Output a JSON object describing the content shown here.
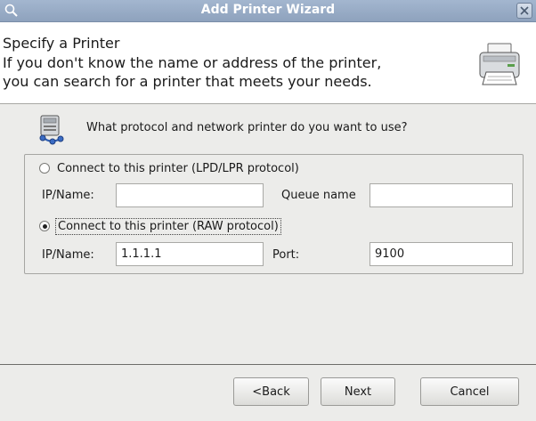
{
  "window": {
    "title": "Add Printer Wizard",
    "icons": {
      "title_left": "search-icon",
      "title_right": "close-icon"
    }
  },
  "header": {
    "title": "Specify a Printer",
    "description": " If you don't know the name or address of the printer,\nyou can search for a printer that meets your needs.",
    "icon": "printer-icon"
  },
  "body": {
    "question": "What protocol and network printer do you want to use?",
    "question_icon": "network-printer-icon",
    "lpd": {
      "label": "Connect to this printer (LPD/LPR protocol)",
      "selected": false,
      "ip_label": "IP/Name:",
      "ip_value": "",
      "queue_label": "Queue name",
      "queue_value": ""
    },
    "raw": {
      "label": "Connect to this printer (RAW protocol)",
      "selected": true,
      "ip_label": "IP/Name:",
      "ip_value": "1.1.1.1",
      "port_label": "Port:",
      "port_value": "9100"
    }
  },
  "footer": {
    "back": "<Back",
    "next": "Next",
    "cancel": "Cancel"
  }
}
